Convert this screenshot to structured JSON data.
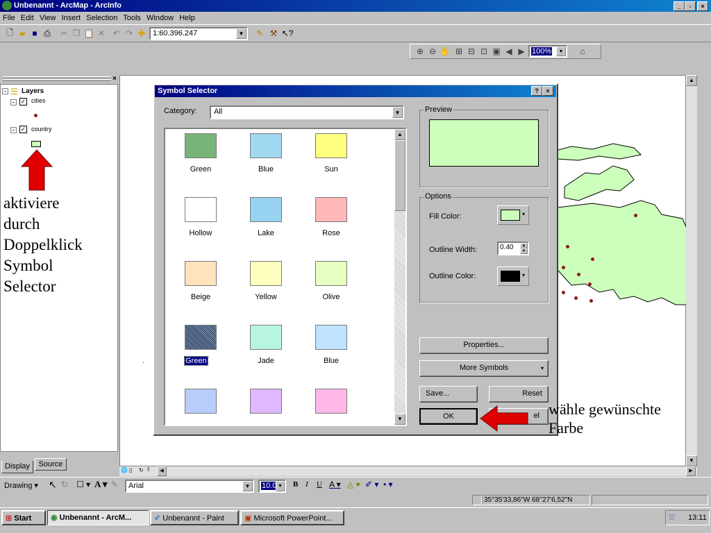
{
  "window": {
    "title": "Unbenannt - ArcMap - ArcInfo"
  },
  "menu": [
    "File",
    "Edit",
    "View",
    "Insert",
    "Selection",
    "Tools",
    "Window",
    "Help"
  ],
  "toolbar": {
    "scale": "1:60.396.247",
    "zoom": "100%"
  },
  "toc": {
    "root": "Layers",
    "layers": [
      {
        "name": "cities"
      },
      {
        "name": "country"
      }
    ],
    "tabs": {
      "display": "Display",
      "source": "Source"
    }
  },
  "annotation_left": {
    "lines": [
      "aktiviere",
      "durch",
      "Doppelklick",
      "Symbol",
      "Selector"
    ]
  },
  "annotation_right": {
    "line1": "wähle gewünschte",
    "line2": "Farbe"
  },
  "dialog": {
    "title": "Symbol Selector",
    "category_label": "Category:",
    "category_value": "All",
    "symbols": [
      {
        "label": "Green",
        "color": "#78b478"
      },
      {
        "label": "Blue",
        "color": "#a0d8ef"
      },
      {
        "label": "Sun",
        "color": "#ffff80"
      },
      {
        "label": "Hollow",
        "color": "#ffffff"
      },
      {
        "label": "Lake",
        "color": "#97d3f0"
      },
      {
        "label": "Rose",
        "color": "#ffb8b8"
      },
      {
        "label": "Beige",
        "color": "#ffe3bc"
      },
      {
        "label": "Yellow",
        "color": "#ffffc0"
      },
      {
        "label": "Olive",
        "color": "#e6ffc0"
      },
      {
        "label": "Green",
        "color": "#4a6080"
      },
      {
        "label": "Jade",
        "color": "#b8f5e0"
      },
      {
        "label": "Blue",
        "color": "#c0e4ff"
      },
      {
        "label": "",
        "color": "#b8cdfc"
      },
      {
        "label": "",
        "color": "#e0b8ff"
      },
      {
        "label": "",
        "color": "#ffb8e8"
      }
    ],
    "preview_label": "Preview",
    "preview_color": "#ccffbb",
    "options_label": "Options",
    "fill_color_label": "Fill Color:",
    "fill_color": "#ccffbb",
    "outline_width_label": "Outline Width:",
    "outline_width": "0.40",
    "outline_color_label": "Outline Color:",
    "outline_color": "#000000",
    "properties_btn": "Properties...",
    "more_symbols_btn": "More Symbols",
    "save_btn": "Save...",
    "reset_btn": "Reset",
    "ok_btn": "OK",
    "cancel_btn_visible": "el"
  },
  "drawing": {
    "label": "Drawing",
    "font": "Arial",
    "size": "10.0"
  },
  "status": {
    "coords": "35°35'33,86\"W  68°27'6,52\"N"
  },
  "taskbar": {
    "start": "Start",
    "items": [
      "Unbenannt - ArcM...",
      "Unbenannt - Paint",
      "Microsoft PowerPoint..."
    ],
    "clock": "13:11"
  },
  "colors": {
    "land": "#ccffbb",
    "city": "#8b1a1a",
    "arrow": "#e00000"
  }
}
